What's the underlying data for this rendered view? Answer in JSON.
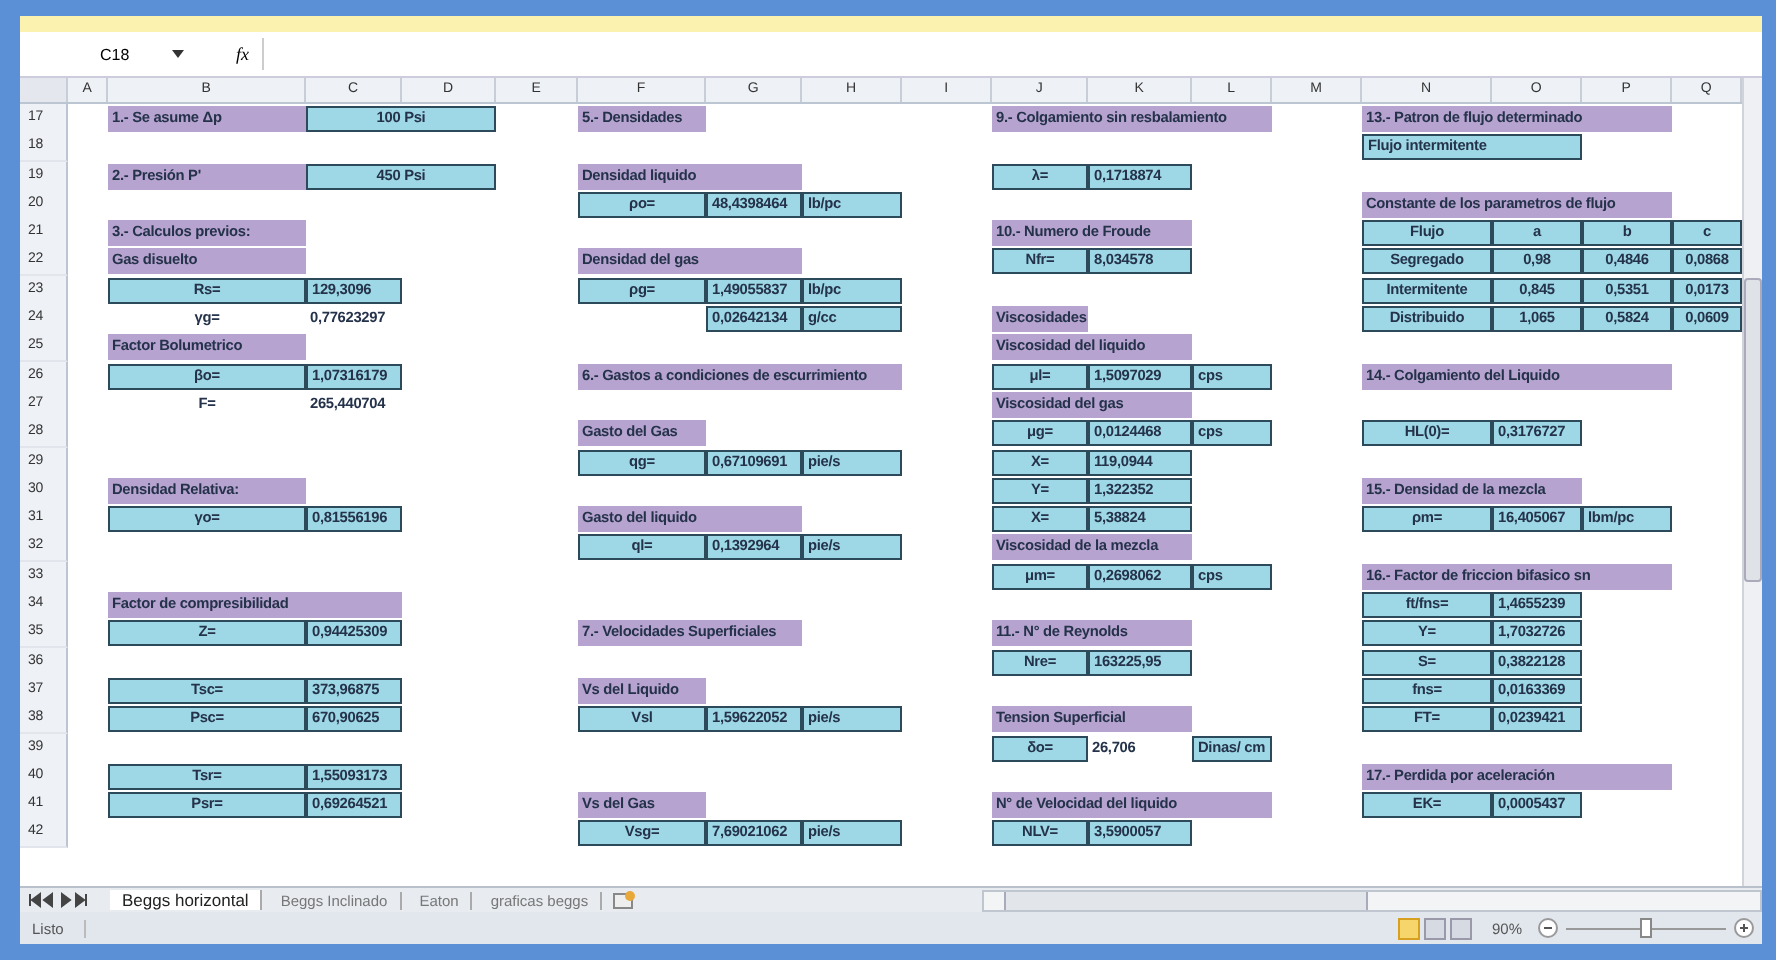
{
  "formula_bar": {
    "name_box": "C18",
    "fx": "fx"
  },
  "columns": [
    "A",
    "B",
    "C",
    "D",
    "E",
    "F",
    "G",
    "H",
    "I",
    "J",
    "K",
    "L",
    "M",
    "N",
    "O",
    "P",
    "Q"
  ],
  "rows": [
    {
      "number": "17",
      "cells": [
        {
          "kind": "title",
          "text": "1.- Se asume Δp"
        },
        {
          "kind": "label",
          "text": "100 Psi"
        },
        {
          "kind": "title",
          "text": "5.- Densidades"
        },
        {
          "kind": "title",
          "text": "9.- Colgamiento sin resbalamiento"
        },
        {
          "kind": "title",
          "text": "13.- Patron de flujo determinado"
        }
      ]
    },
    {
      "number": "18",
      "cells": [
        {
          "kind": "value",
          "text": "Flujo intermitente"
        }
      ]
    },
    {
      "number": "19",
      "cells": [
        {
          "kind": "title",
          "text": "2.- Presión P'"
        },
        {
          "kind": "label",
          "text": "450 Psi"
        },
        {
          "kind": "title",
          "text": "Densidad liquido"
        },
        {
          "kind": "label",
          "text": "λ="
        },
        {
          "kind": "value",
          "text": "0,1718874"
        }
      ]
    },
    {
      "number": "20",
      "cells": [
        {
          "kind": "label",
          "text": "ρo="
        },
        {
          "kind": "value",
          "text": "48,4398464"
        },
        {
          "kind": "value",
          "text": "lb/pc"
        },
        {
          "kind": "title",
          "text": "Constante de los parametros de flujo"
        }
      ]
    },
    {
      "number": "21",
      "cells": [
        {
          "kind": "title",
          "text": "3.- Calculos previos:"
        },
        {
          "kind": "title",
          "text": "10.- Numero de Froude"
        },
        {
          "kind": "label",
          "text": "Flujo"
        },
        {
          "kind": "label",
          "text": "a"
        },
        {
          "kind": "label",
          "text": "b"
        },
        {
          "kind": "label",
          "text": "c"
        }
      ]
    },
    {
      "number": "22",
      "cells": [
        {
          "kind": "title",
          "text": "Gas disuelto"
        },
        {
          "kind": "title",
          "text": "Densidad del gas"
        },
        {
          "kind": "label",
          "text": "Nfr="
        },
        {
          "kind": "value",
          "text": "8,034578"
        },
        {
          "kind": "label",
          "text": "Segregado"
        },
        {
          "kind": "label",
          "text": "0,98"
        },
        {
          "kind": "label",
          "text": "0,4846"
        },
        {
          "kind": "label",
          "text": "0,0868"
        }
      ]
    },
    {
      "number": "23",
      "cells": [
        {
          "kind": "label",
          "text": "Rs="
        },
        {
          "kind": "value",
          "text": "129,3096"
        },
        {
          "kind": "label",
          "text": "ρg="
        },
        {
          "kind": "value",
          "text": "1,49055837"
        },
        {
          "kind": "value",
          "text": "lb/pc"
        },
        {
          "kind": "label",
          "text": "Intermitente"
        },
        {
          "kind": "label",
          "text": "0,845"
        },
        {
          "kind": "label",
          "text": "0,5351"
        },
        {
          "kind": "label",
          "text": "0,0173"
        }
      ]
    },
    {
      "number": "24",
      "cells": [
        {
          "kind": "note",
          "text": "γg="
        },
        {
          "kind": "number",
          "text": "0,77623297"
        },
        {
          "kind": "value",
          "text": "0,02642134"
        },
        {
          "kind": "value",
          "text": "g/cc"
        },
        {
          "kind": "title",
          "text": "Viscosidades"
        },
        {
          "kind": "label",
          "text": "Distribuido"
        },
        {
          "kind": "label",
          "text": "1,065"
        },
        {
          "kind": "label",
          "text": "0,5824"
        },
        {
          "kind": "label",
          "text": "0,0609"
        }
      ]
    },
    {
      "number": "25",
      "cells": [
        {
          "kind": "title",
          "text": "Factor Bolumetrico"
        },
        {
          "kind": "title",
          "text": "Viscosidad del liquido"
        }
      ]
    },
    {
      "number": "26",
      "cells": [
        {
          "kind": "label",
          "text": "βo="
        },
        {
          "kind": "value",
          "text": "1,07316179"
        },
        {
          "kind": "title",
          "text": "6.- Gastos a condiciones de escurrimiento"
        },
        {
          "kind": "label",
          "text": "μl="
        },
        {
          "kind": "value",
          "text": "1,5097029"
        },
        {
          "kind": "value",
          "text": "cps"
        },
        {
          "kind": "title",
          "text": "14.- Colgamiento del Liquido"
        }
      ]
    },
    {
      "number": "27",
      "cells": [
        {
          "kind": "note",
          "text": "F="
        },
        {
          "kind": "number",
          "text": "265,440704"
        },
        {
          "kind": "title",
          "text": "Viscosidad del gas"
        }
      ]
    },
    {
      "number": "28",
      "cells": [
        {
          "kind": "title",
          "text": "Gasto del Gas"
        },
        {
          "kind": "label",
          "text": "μg="
        },
        {
          "kind": "value",
          "text": "0,0124468"
        },
        {
          "kind": "value",
          "text": "cps"
        },
        {
          "kind": "label",
          "text": "HL(0)="
        },
        {
          "kind": "value",
          "text": "0,3176727"
        }
      ]
    },
    {
      "number": "29",
      "cells": [
        {
          "kind": "label",
          "text": "qg="
        },
        {
          "kind": "value",
          "text": "0,67109691"
        },
        {
          "kind": "value",
          "text": "pie/s"
        },
        {
          "kind": "label",
          "text": "X="
        },
        {
          "kind": "value",
          "text": "119,0944"
        }
      ]
    },
    {
      "number": "30",
      "cells": [
        {
          "kind": "title",
          "text": "Densidad Relativa:"
        },
        {
          "kind": "label",
          "text": "Y="
        },
        {
          "kind": "value",
          "text": "1,322352"
        },
        {
          "kind": "title",
          "text": "15.- Densidad de la mezcla"
        }
      ]
    },
    {
      "number": "31",
      "cells": [
        {
          "kind": "label",
          "text": "γo="
        },
        {
          "kind": "value",
          "text": "0,81556196"
        },
        {
          "kind": "title",
          "text": "Gasto del liquido"
        },
        {
          "kind": "label",
          "text": "X="
        },
        {
          "kind": "value",
          "text": "5,38824"
        },
        {
          "kind": "label",
          "text": "ρm="
        },
        {
          "kind": "value",
          "text": "16,405067"
        },
        {
          "kind": "value",
          "text": "lbm/pc"
        }
      ]
    },
    {
      "number": "32",
      "cells": [
        {
          "kind": "label",
          "text": "ql="
        },
        {
          "kind": "value",
          "text": "0,1392964"
        },
        {
          "kind": "value",
          "text": "pie/s"
        },
        {
          "kind": "title",
          "text": "Viscosidad de la mezcla"
        }
      ]
    },
    {
      "number": "33",
      "cells": [
        {
          "kind": "label",
          "text": "μm="
        },
        {
          "kind": "value",
          "text": "0,2698062"
        },
        {
          "kind": "value",
          "text": "cps"
        },
        {
          "kind": "title",
          "text": "16.- Factor de friccion bifasico sn"
        }
      ]
    },
    {
      "number": "34",
      "cells": [
        {
          "kind": "title",
          "text": "Factor de compresibilidad"
        },
        {
          "kind": "label",
          "text": "ft/fns="
        },
        {
          "kind": "value",
          "text": "1,4655239"
        }
      ]
    },
    {
      "number": "35",
      "cells": [
        {
          "kind": "label",
          "text": "Z="
        },
        {
          "kind": "value",
          "text": "0,94425309"
        },
        {
          "kind": "title",
          "text": "7.- Velocidades Superficiales"
        },
        {
          "kind": "title",
          "text": "11.- N° de Reynolds"
        },
        {
          "kind": "label",
          "text": "Y="
        },
        {
          "kind": "value",
          "text": "1,7032726"
        }
      ]
    },
    {
      "number": "36",
      "cells": [
        {
          "kind": "label",
          "text": "Nre="
        },
        {
          "kind": "value",
          "text": "163225,95"
        },
        {
          "kind": "label",
          "text": "S="
        },
        {
          "kind": "value",
          "text": "0,3822128"
        }
      ]
    },
    {
      "number": "37",
      "cells": [
        {
          "kind": "label",
          "text": "Tsc="
        },
        {
          "kind": "value",
          "text": "373,96875"
        },
        {
          "kind": "title",
          "text": "Vs del Liquido"
        },
        {
          "kind": "label",
          "text": "fns="
        },
        {
          "kind": "value",
          "text": "0,0163369"
        }
      ]
    },
    {
      "number": "38",
      "cells": [
        {
          "kind": "label",
          "text": "Psc="
        },
        {
          "kind": "value",
          "text": "670,90625"
        },
        {
          "kind": "label",
          "text": "Vsl"
        },
        {
          "kind": "value",
          "text": "1,59622052"
        },
        {
          "kind": "value",
          "text": "pie/s"
        },
        {
          "kind": "title",
          "text": "Tension Superficial"
        },
        {
          "kind": "label",
          "text": "FT="
        },
        {
          "kind": "value",
          "text": "0,0239421"
        }
      ]
    },
    {
      "number": "39",
      "cells": [
        {
          "kind": "label",
          "text": "δo="
        },
        {
          "kind": "number",
          "text": "26,706"
        },
        {
          "kind": "value",
          "text": "Dinas/ cm"
        }
      ]
    },
    {
      "number": "40",
      "cells": [
        {
          "kind": "label",
          "text": "Tsr="
        },
        {
          "kind": "value",
          "text": "1,55093173"
        },
        {
          "kind": "title",
          "text": "17.- Perdida por aceleración"
        }
      ]
    },
    {
      "number": "41",
      "cells": [
        {
          "kind": "label",
          "text": "Psr="
        },
        {
          "kind": "value",
          "text": "0,69264521"
        },
        {
          "kind": "title",
          "text": "Vs del Gas"
        },
        {
          "kind": "title",
          "text": "N° de Velocidad del liquido"
        },
        {
          "kind": "label",
          "text": "EK="
        },
        {
          "kind": "value",
          "text": "0,0005437"
        }
      ]
    },
    {
      "number": "42",
      "cells": [
        {
          "kind": "label",
          "text": "Vsg="
        },
        {
          "kind": "value",
          "text": "7,69021062"
        },
        {
          "kind": "value",
          "text": "pie/s"
        },
        {
          "kind": "label",
          "text": "NLV="
        },
        {
          "kind": "value",
          "text": "3,5900057"
        }
      ]
    }
  ],
  "sheet_tabs": [
    {
      "label": "Beggs horizontal",
      "selected": true
    },
    {
      "label": "Beggs Inclinado",
      "selected": false
    },
    {
      "label": "Eaton",
      "selected": false
    },
    {
      "label": "graficas beggs",
      "selected": false
    }
  ],
  "status_bar": {
    "text": "Listo",
    "views": [
      {
        "selected": true
      },
      {
        "selected": false
      },
      {
        "selected": false
      }
    ],
    "zoom": "90%",
    "zoom_slider": {
      "level": 0.5
    }
  }
}
